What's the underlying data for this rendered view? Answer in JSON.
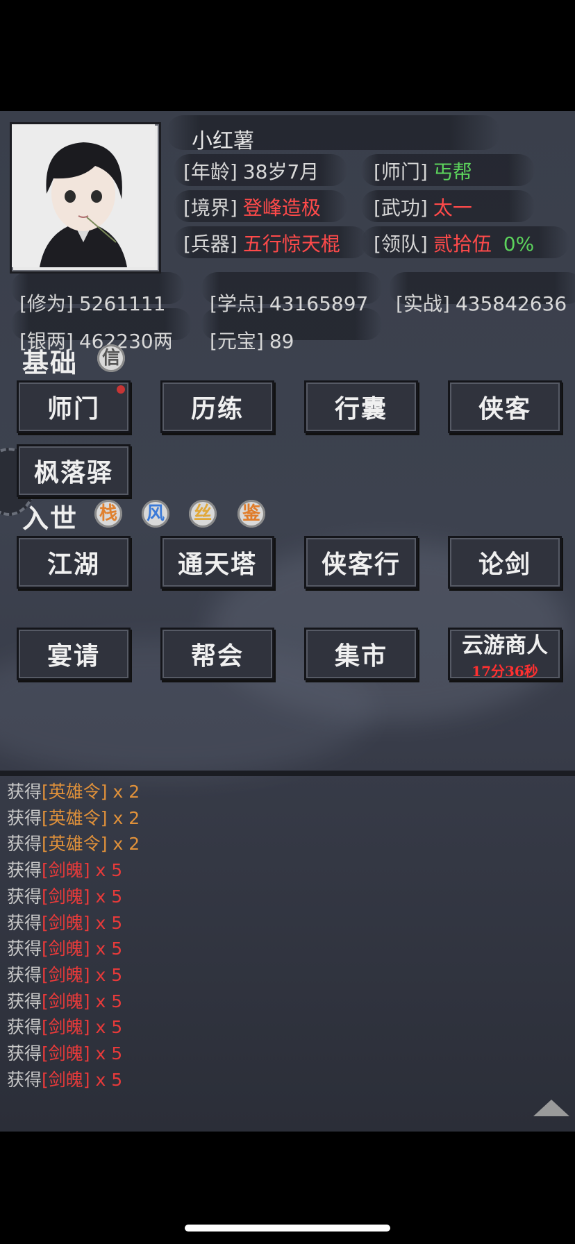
{
  "character": {
    "name": "小红薯",
    "stats_top": [
      {
        "key": "[年龄]",
        "value": "38岁7月",
        "color": "#d9d9d9"
      },
      {
        "key": "[师门]",
        "value": "丐帮",
        "color": "#5cd35c"
      },
      {
        "key": "[境界]",
        "value": "登峰造极",
        "color": "#ff4a4a"
      },
      {
        "key": "[武功]",
        "value": "太一",
        "color": "#ff4a4a"
      },
      {
        "key": "[兵器]",
        "value": "五行惊天棍",
        "color": "#ff4a4a"
      },
      {
        "key": "[领队]",
        "value": "贰拾伍",
        "color": "#ff4a4a",
        "extra": "0%",
        "extra_color": "#5cd35c"
      }
    ],
    "stats_bottom": [
      {
        "key": "[修为]",
        "value": "5261111"
      },
      {
        "key": "[学点]",
        "value": "43165897"
      },
      {
        "key": "[实战]",
        "value": "435842636"
      },
      {
        "key": "[银两]",
        "value": "462230两"
      },
      {
        "key": "[元宝]",
        "value": "89"
      }
    ]
  },
  "sections": {
    "basic": {
      "title": "基础",
      "seal": "信",
      "buttons": [
        "师门",
        "历练",
        "行囊",
        "侠客",
        "枫落驿"
      ]
    },
    "world": {
      "title": "入世",
      "seals": [
        {
          "label": "栈",
          "color": "#e0812f"
        },
        {
          "label": "风",
          "color": "#3b7ad8"
        },
        {
          "label": "丝",
          "color": "#e0a83a"
        },
        {
          "label": "鉴",
          "color": "#e07c2a"
        }
      ],
      "buttons": [
        "江湖",
        "通天塔",
        "侠客行",
        "论剑",
        "宴请",
        "帮会",
        "集市"
      ],
      "merchant": {
        "label": "云游商人",
        "timer": "17分36秒"
      }
    }
  },
  "log": [
    {
      "prefix": "获得",
      "item": "[英雄令]",
      "qty": "x 2",
      "type": "gold"
    },
    {
      "prefix": "获得",
      "item": "[英雄令]",
      "qty": "x 2",
      "type": "gold"
    },
    {
      "prefix": "获得",
      "item": "[英雄令]",
      "qty": "x 2",
      "type": "gold"
    },
    {
      "prefix": "获得",
      "item": "[剑魄]",
      "qty": "x 5",
      "type": "red"
    },
    {
      "prefix": "获得",
      "item": "[剑魄]",
      "qty": "x 5",
      "type": "red"
    },
    {
      "prefix": "获得",
      "item": "[剑魄]",
      "qty": "x 5",
      "type": "red"
    },
    {
      "prefix": "获得",
      "item": "[剑魄]",
      "qty": "x 5",
      "type": "red"
    },
    {
      "prefix": "获得",
      "item": "[剑魄]",
      "qty": "x 5",
      "type": "red"
    },
    {
      "prefix": "获得",
      "item": "[剑魄]",
      "qty": "x 5",
      "type": "red"
    },
    {
      "prefix": "获得",
      "item": "[剑魄]",
      "qty": "x 5",
      "type": "red"
    },
    {
      "prefix": "获得",
      "item": "[剑魄]",
      "qty": "x 5",
      "type": "red"
    },
    {
      "prefix": "获得",
      "item": "[剑魄]",
      "qty": "x 5",
      "type": "red"
    }
  ],
  "colors": {
    "log_gold": "#e0913a",
    "log_red": "#e83a3a"
  },
  "icons": {
    "scroll_up": "triangle-up-icon",
    "home_indicator": "home-bar"
  }
}
